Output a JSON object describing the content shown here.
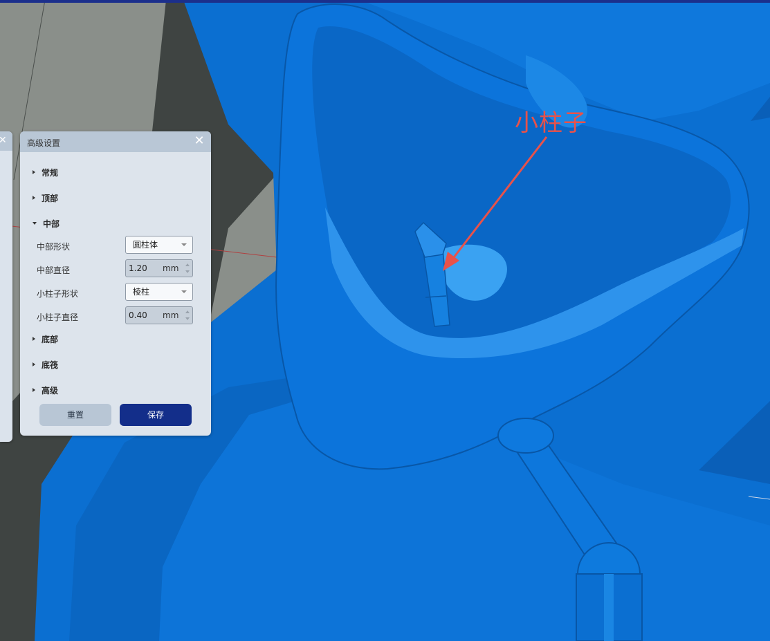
{
  "colors": {
    "mesh_blue": "#0a6fd0",
    "mesh_light": "#3d9bef",
    "accent_navy": "#132e8a",
    "annotation_red": "#e8524a"
  },
  "annotation": {
    "text": "小柱子"
  },
  "panel": {
    "title": "高级设置",
    "close_icon": "close-icon",
    "sections": {
      "general": "常规",
      "top": "顶部",
      "middle": "中部",
      "bottom": "底部",
      "raft": "底筏",
      "advanced": "高级"
    },
    "middle": {
      "shape_label": "中部形状",
      "shape_value": "圆柱体",
      "diameter_label": "中部直径",
      "diameter_value": "1.20",
      "diameter_unit": "mm",
      "pillar_shape_label": "小柱子形状",
      "pillar_shape_value": "棱柱",
      "pillar_diameter_label": "小柱子直径",
      "pillar_diameter_value": "0.40",
      "pillar_diameter_unit": "mm"
    },
    "buttons": {
      "reset": "重置",
      "save": "保存"
    }
  }
}
